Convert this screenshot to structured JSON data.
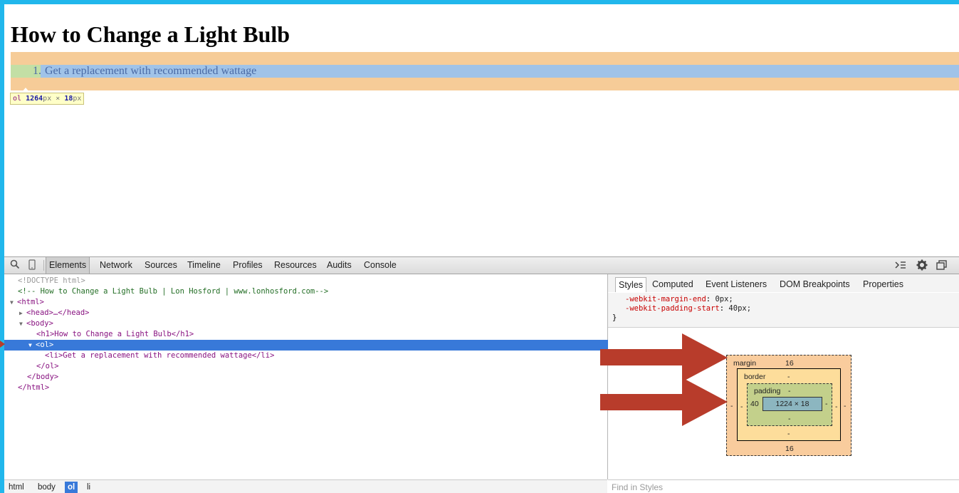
{
  "page": {
    "title": "How to Change a Light Bulb",
    "list_number": "1.",
    "list_item": "Get a replacement with recommended wattage",
    "tooltip": {
      "tag": "ol",
      "width": "1264",
      "height": "18",
      "unit": "px",
      "times": "×"
    }
  },
  "devtools": {
    "toolbar": {
      "tabs": [
        "Elements",
        "Network",
        "Sources",
        "Timeline",
        "Profiles",
        "Resources",
        "Audits",
        "Console"
      ],
      "active_tab": "Elements"
    },
    "dom": {
      "doctype": "<!DOCTYPE html>",
      "comment": "<!-- How to Change a Light Bulb | Lon Hosford | www.lonhosford.com-->",
      "html_open": "<html>",
      "head": "<head>…</head>",
      "body_open": "<body>",
      "h1": "<h1>How to Change a Light Bulb</h1>",
      "ol_open": "<ol>",
      "li": "<li>Get a replacement with recommended wattage</li>",
      "ol_close": "</ol>",
      "body_close": "</body>",
      "html_close": "</html>"
    },
    "breadcrumbs": [
      "html",
      "body",
      "ol",
      "li"
    ],
    "active_breadcrumb": "ol",
    "sidebar": {
      "tabs": [
        "Styles",
        "Computed",
        "Event Listeners",
        "DOM Breakpoints",
        "Properties"
      ],
      "active_tab": "Styles",
      "rules": [
        {
          "prop": "-webkit-margin-end",
          "value": "0px;"
        },
        {
          "prop": "-webkit-padding-start",
          "value": "40px;"
        }
      ],
      "rule_close": "}",
      "box_model": {
        "margin_label": "margin",
        "margin_top": "16",
        "margin_bottom": "16",
        "margin_side": "-",
        "border_label": "border",
        "border_value": "-",
        "padding_label": "padding",
        "padding_top": "-",
        "padding_left": "40",
        "padding_right": "-",
        "padding_bottom": "-",
        "content": "1224 × 18"
      },
      "find_placeholder": "Find in Styles"
    }
  },
  "colors": {
    "frame_border": "#21b7ec",
    "margin_highlight": "#f6cc98",
    "padding_highlight": "#c3dfa5",
    "content_highlight": "#a0c3e8",
    "selection": "#3879d9",
    "annotation_arrow": "#b83c2b"
  }
}
